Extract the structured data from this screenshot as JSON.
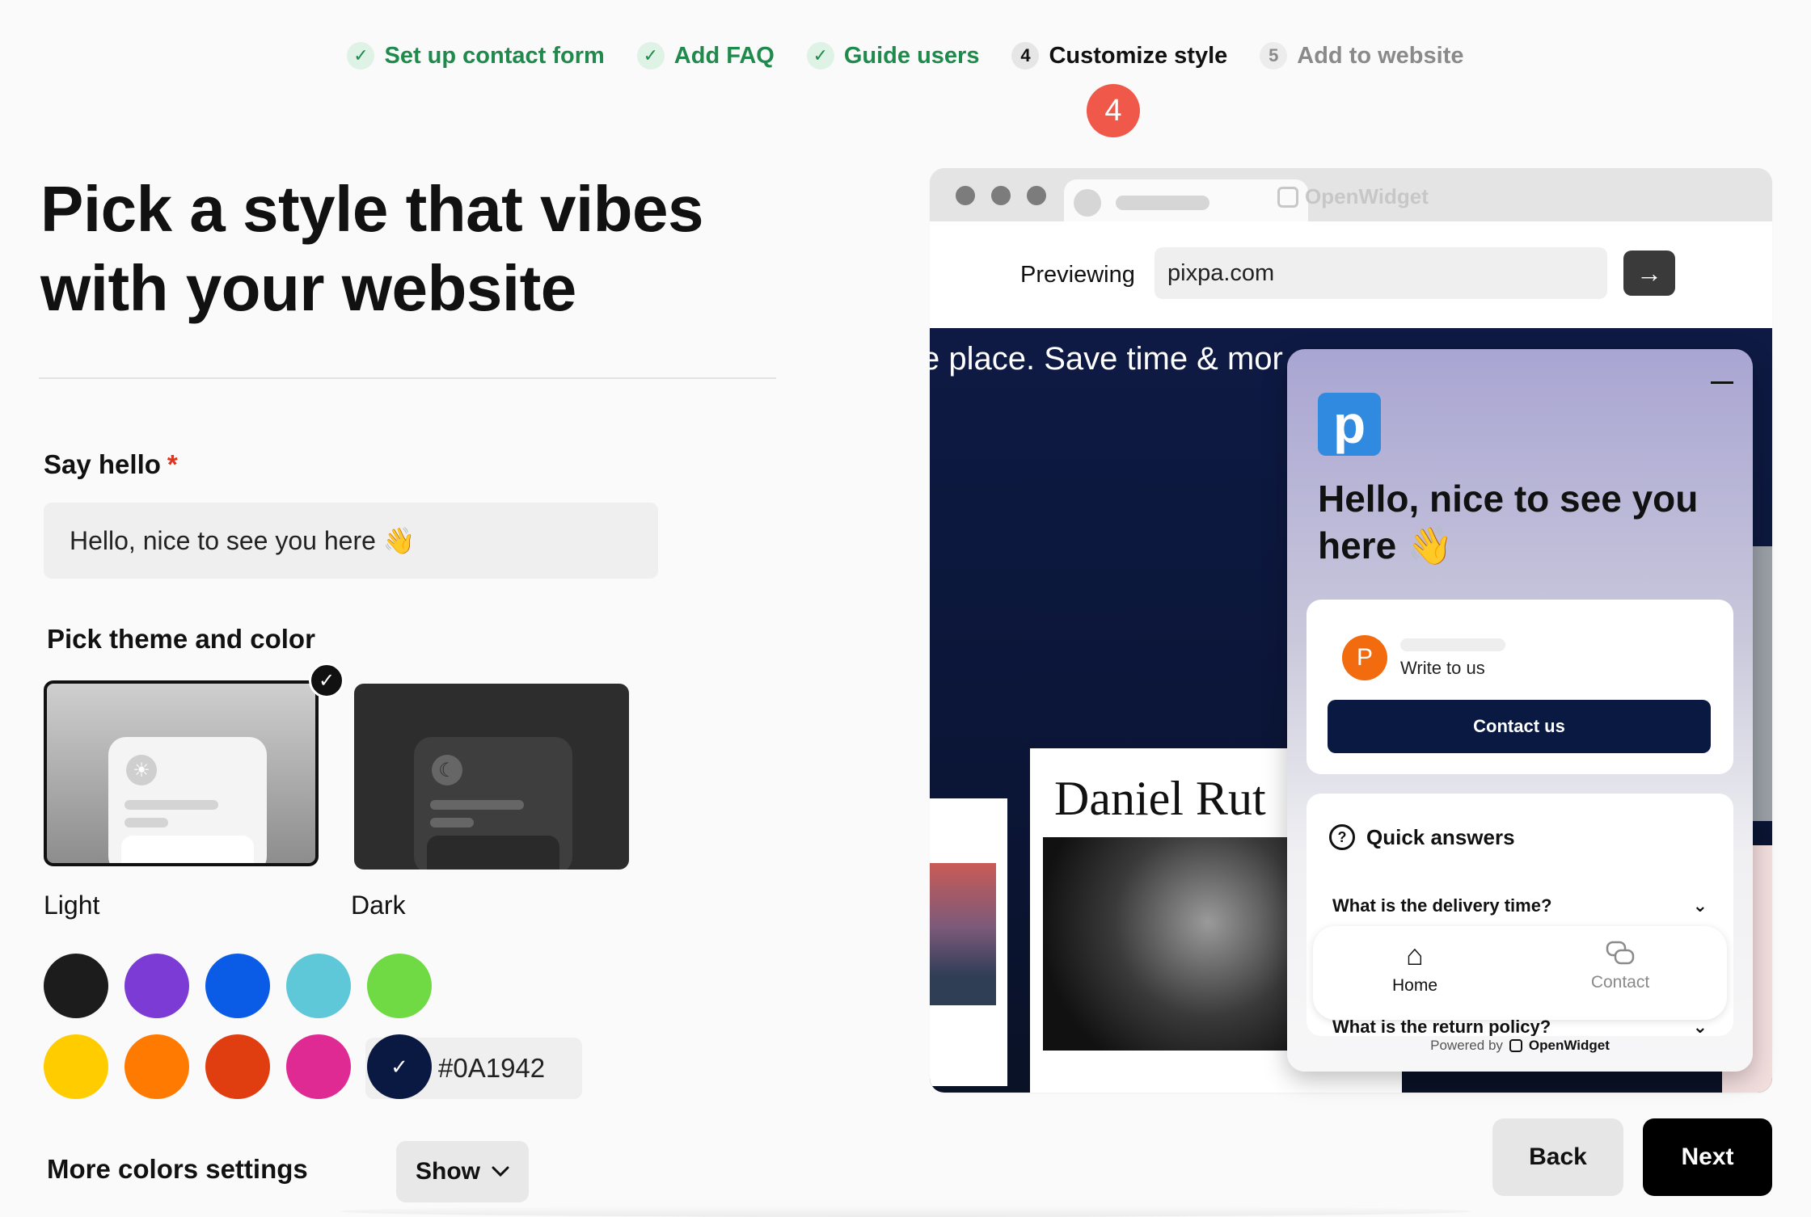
{
  "stepper": {
    "steps": [
      {
        "mark": "✓",
        "label": "Set up contact form"
      },
      {
        "mark": "✓",
        "label": "Add FAQ"
      },
      {
        "mark": "✓",
        "label": "Guide users"
      },
      {
        "mark": "4",
        "label": "Customize style"
      },
      {
        "mark": "5",
        "label": "Add to website"
      }
    ],
    "annotation": "4"
  },
  "page": {
    "title_line1": "Pick a style that vibes",
    "title_line2": "with your website"
  },
  "say_hello": {
    "label": "Say hello",
    "required_mark": "*",
    "value": "Hello, nice to see you here 👋"
  },
  "theme": {
    "label": "Pick theme and color",
    "light_label": "Light",
    "dark_label": "Dark",
    "selected_check": "✓"
  },
  "colors": {
    "swatches": [
      "#1c1c1c",
      "#7b3bd4",
      "#0a5ce6",
      "#5ec8d8",
      "#6fda44",
      "#ffcc00",
      "#ff7a00",
      "#e03d10",
      "#e02a93",
      "#0A1942"
    ],
    "selected_check": "✓",
    "hex_value": "#0A1942"
  },
  "more_colors": {
    "label": "More colors settings",
    "button": "Show"
  },
  "browser": {
    "brand_ghost": "OpenWidget",
    "previewing_label": "Previewing",
    "url": "pixpa.com",
    "go_icon": "→",
    "site_headline": "e place. Save time & mor",
    "site_name": "Daniel Rut"
  },
  "widget": {
    "logo_letter": "p",
    "greeting": "Hello, nice to see you here 👋",
    "avatar_letter": "P",
    "write_to_us": "Write to us",
    "contact_button": "Contact us",
    "quick_answers": "Quick answers",
    "q1": "What is the delivery time?",
    "q2": "What is the return policy?",
    "chevron": "⌄",
    "nav_home": "Home",
    "nav_contact": "Contact",
    "powered_by": "Powered by",
    "powered_brand": "OpenWidget"
  },
  "footer": {
    "back": "Back",
    "next": "Next"
  }
}
